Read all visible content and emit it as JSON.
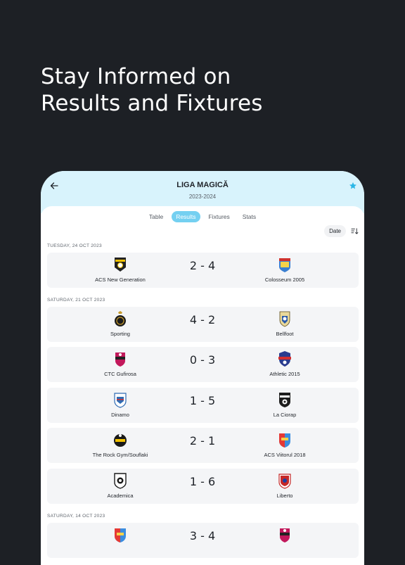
{
  "headline": {
    "line1": "Stay Informed on",
    "line2": "Results and Fixtures"
  },
  "header": {
    "league": "LIGA MAGICĂ",
    "season": "2023-2024",
    "back_icon": "arrow-left-icon",
    "favorite_icon": "star-icon"
  },
  "tabs": [
    {
      "label": "Table",
      "active": false
    },
    {
      "label": "Results",
      "active": true
    },
    {
      "label": "Fixtures",
      "active": false
    },
    {
      "label": "Stats",
      "active": false
    }
  ],
  "sort": {
    "label": "Date",
    "icon": "sort-descending-icon"
  },
  "colors": {
    "accent": "#74d0f1",
    "header_bg": "#d8f3fc",
    "background": "#1d2025",
    "star": "#29b6e6"
  },
  "days": [
    {
      "label": "TUESDAY, 24 OCT 2023",
      "matches": [
        {
          "home": "ACS New Generation",
          "score": "2 - 4",
          "away": "Colosseum 2005"
        }
      ]
    },
    {
      "label": "SATURDAY, 21 OCT 2023",
      "matches": [
        {
          "home": "Sporting",
          "score": "4 - 2",
          "away": "Bellfoot"
        },
        {
          "home": "CTC Gufirosa",
          "score": "0 - 3",
          "away": "Athletic 2015"
        },
        {
          "home": "Dinamo",
          "score": "1 - 5",
          "away": "La Ciorap"
        },
        {
          "home": "The Rock Gym/Souflaki",
          "score": "2 - 1",
          "away": "ACS Viitorul 2018"
        },
        {
          "home": "Academica",
          "score": "1 - 6",
          "away": "Liberto"
        }
      ]
    },
    {
      "label": "SATURDAY, 14 OCT 2023",
      "matches": [
        {
          "home": "",
          "score": "3 - 4",
          "away": ""
        }
      ]
    }
  ]
}
